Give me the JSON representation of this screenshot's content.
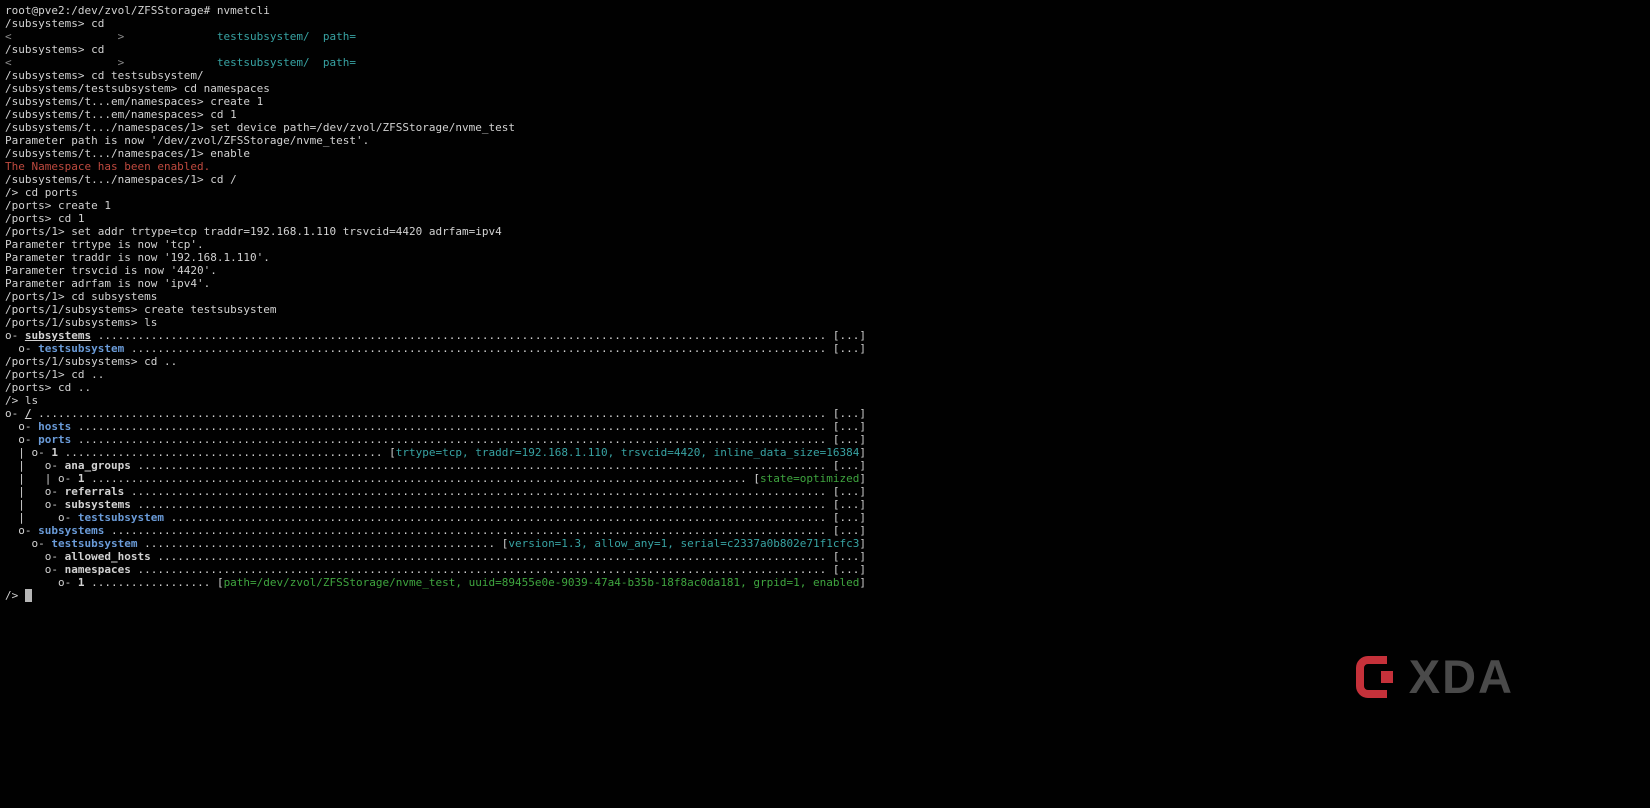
{
  "terminal": {
    "columns": 130,
    "colors": {
      "background": "#010101",
      "default": "#d2d2d2",
      "blue": "#6a9bd8",
      "teal": "#38a3a3",
      "green": "#3fa53f",
      "red": "#bf4a3f",
      "dim": "#8a8a8a",
      "cursor": "#b6b6b6"
    },
    "lines": [
      [
        {
          "t": "root@pve2:/dev/zvol/ZFSStorage# nvmetcli"
        }
      ],
      [
        {
          "t": "/subsystems> cd"
        }
      ],
      [
        {
          "t": "<                >",
          "c": "dim"
        },
        {
          "t": "              "
        },
        {
          "t": "testsubsystem/",
          "c": "teal"
        },
        {
          "t": "  "
        },
        {
          "t": "path=",
          "c": "teal"
        }
      ],
      [
        {
          "t": "/subsystems> cd"
        }
      ],
      [
        {
          "t": "<                >",
          "c": "dim"
        },
        {
          "t": "              "
        },
        {
          "t": "testsubsystem/",
          "c": "teal"
        },
        {
          "t": "  "
        },
        {
          "t": "path=",
          "c": "teal"
        }
      ],
      [
        {
          "t": "/subsystems> cd testsubsystem/"
        }
      ],
      [
        {
          "t": "/subsystems/testsubsystem> cd namespaces"
        }
      ],
      [
        {
          "t": "/subsystems/t...em/namespaces> create 1"
        }
      ],
      [
        {
          "t": "/subsystems/t...em/namespaces> cd 1"
        }
      ],
      [
        {
          "t": "/subsystems/t.../namespaces/1> set device path=/dev/zvol/ZFSStorage/nvme_test"
        }
      ],
      [
        {
          "t": "Parameter path is now '/dev/zvol/ZFSStorage/nvme_test'."
        }
      ],
      [
        {
          "t": "/subsystems/t.../namespaces/1> enable"
        }
      ],
      [
        {
          "t": "The Namespace has been enabled.",
          "c": "red"
        }
      ],
      [
        {
          "t": "/subsystems/t.../namespaces/1> cd /"
        }
      ],
      [
        {
          "t": "/> cd ports"
        }
      ],
      [
        {
          "t": "/ports> create 1"
        }
      ],
      [
        {
          "t": "/ports> cd 1"
        }
      ],
      [
        {
          "t": "/ports/1> set addr trtype=tcp traddr=192.168.1.110 trsvcid=4420 adrfam=ipv4"
        }
      ],
      [
        {
          "t": "Parameter trtype is now 'tcp'."
        }
      ],
      [
        {
          "t": "Parameter traddr is now '192.168.1.110'."
        }
      ],
      [
        {
          "t": "Parameter trsvcid is now '4420'."
        }
      ],
      [
        {
          "t": "Parameter adrfam is now 'ipv4'."
        }
      ],
      [
        {
          "t": "/ports/1> cd subsystems"
        }
      ],
      [
        {
          "t": "/ports/1/subsystems> create testsubsystem"
        }
      ],
      [
        {
          "t": "/ports/1/subsystems> ls"
        }
      ],
      [
        {
          "t": "o- "
        },
        {
          "t": "subsystems",
          "b": true,
          "u": true
        },
        {
          "fill": true
        },
        {
          "t": "[...]"
        }
      ],
      [
        {
          "t": "  o- "
        },
        {
          "t": "testsubsystem",
          "c": "blue",
          "b": true
        },
        {
          "fill": true
        },
        {
          "t": "[...]"
        }
      ],
      [
        {
          "t": "/ports/1/subsystems> cd .."
        }
      ],
      [
        {
          "t": "/ports/1> cd .."
        }
      ],
      [
        {
          "t": "/ports> cd .."
        }
      ],
      [
        {
          "t": "/> ls"
        }
      ],
      [
        {
          "t": "o- "
        },
        {
          "t": "/",
          "b": true,
          "u": true
        },
        {
          "fill": true
        },
        {
          "t": "[...]"
        }
      ],
      [
        {
          "t": "  o- "
        },
        {
          "t": "hosts",
          "c": "blue",
          "b": true
        },
        {
          "fill": true
        },
        {
          "t": "[...]"
        }
      ],
      [
        {
          "t": "  o- "
        },
        {
          "t": "ports",
          "c": "blue",
          "b": true
        },
        {
          "fill": true
        },
        {
          "t": "[...]"
        }
      ],
      [
        {
          "t": "  | o- "
        },
        {
          "t": "1",
          "b": true
        },
        {
          "fill": true
        },
        {
          "t": "["
        },
        {
          "t": "trtype=tcp, traddr=192.168.1.110, trsvcid=4420, inline_data_size=16384",
          "c": "teal"
        },
        {
          "t": "]"
        }
      ],
      [
        {
          "t": "  |   o- "
        },
        {
          "t": "ana_groups",
          "b": true
        },
        {
          "fill": true
        },
        {
          "t": "[...]"
        }
      ],
      [
        {
          "t": "  |   | o- "
        },
        {
          "t": "1",
          "b": true
        },
        {
          "fill": true
        },
        {
          "t": "["
        },
        {
          "t": "state=optimized",
          "c": "green"
        },
        {
          "t": "]"
        }
      ],
      [
        {
          "t": "  |   o- "
        },
        {
          "t": "referrals",
          "b": true
        },
        {
          "fill": true
        },
        {
          "t": "[...]"
        }
      ],
      [
        {
          "t": "  |   o- "
        },
        {
          "t": "subsystems",
          "b": true
        },
        {
          "fill": true
        },
        {
          "t": "[...]"
        }
      ],
      [
        {
          "t": "  |     o- "
        },
        {
          "t": "testsubsystem",
          "c": "blue",
          "b": true
        },
        {
          "fill": true
        },
        {
          "t": "[...]"
        }
      ],
      [
        {
          "t": "  o- "
        },
        {
          "t": "subsystems",
          "c": "blue",
          "b": true
        },
        {
          "fill": true
        },
        {
          "t": "[...]"
        }
      ],
      [
        {
          "t": "    o- "
        },
        {
          "t": "testsubsystem",
          "c": "blue",
          "b": true
        },
        {
          "fill": true
        },
        {
          "t": "["
        },
        {
          "t": "version=1.3, allow_any=1, serial=c2337a0b802e71f1cfc3",
          "c": "teal"
        },
        {
          "t": "]"
        }
      ],
      [
        {
          "t": "      o- "
        },
        {
          "t": "allowed_hosts",
          "b": true
        },
        {
          "fill": true
        },
        {
          "t": "[...]"
        }
      ],
      [
        {
          "t": "      o- "
        },
        {
          "t": "namespaces",
          "b": true
        },
        {
          "fill": true
        },
        {
          "t": "[...]"
        }
      ],
      [
        {
          "t": "        o- "
        },
        {
          "t": "1",
          "b": true
        },
        {
          "fill": true
        },
        {
          "t": "["
        },
        {
          "t": "path=/dev/zvol/ZFSStorage/nvme_test, uuid=89455e0e-9039-47a4-b35b-18f8ac0da181, grpid=1, enabled",
          "c": "green"
        },
        {
          "t": "]"
        }
      ],
      [
        {
          "t": "/> "
        },
        {
          "t": " ",
          "cursor": true
        }
      ]
    ]
  },
  "logo": {
    "text": "XDA",
    "icon_color": "#c5313a",
    "text_color": "#4a4a4a"
  }
}
